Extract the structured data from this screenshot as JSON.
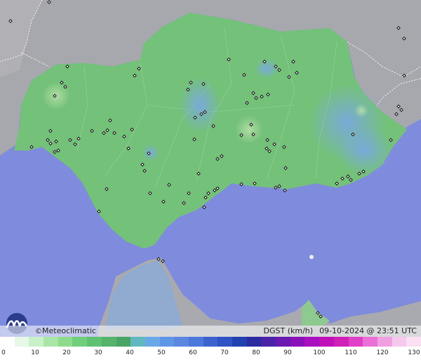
{
  "brand": {
    "copyright": "©",
    "name": "Meteoclimatic"
  },
  "product": {
    "variable": "DGST (km/h)",
    "datetime": "09-10-2024 @ 23:51 UTC"
  },
  "colors": {
    "sea": "#7f8bdc",
    "land_grey": "#a9a9ad",
    "region_green": "#76c07a",
    "gust_blue": "#8fb3e6",
    "station_marker": "#111111"
  },
  "legend": {
    "ticks": [
      "0",
      "10",
      "20",
      "30",
      "40",
      "50",
      "60",
      "70",
      "80",
      "90",
      "100",
      "110",
      "120",
      "130"
    ],
    "colors": [
      "#ffffff",
      "#e6f8e6",
      "#c9f0c9",
      "#a8e6a8",
      "#8ddc8d",
      "#6fcf7a",
      "#5fc172",
      "#55b36c",
      "#4aa466",
      "#62b8c0",
      "#6aa8e8",
      "#5f96e6",
      "#5c86e0",
      "#4c78dc",
      "#3c62d0",
      "#2f52c4",
      "#2240b0",
      "#2b2aa0",
      "#4a22a8",
      "#6a18b0",
      "#8a10b8",
      "#a810c0",
      "#c010b8",
      "#d020b8",
      "#e040c8",
      "#ea70d8",
      "#f0a0e0",
      "#f6c8ec",
      "#fae0f2"
    ]
  }
}
